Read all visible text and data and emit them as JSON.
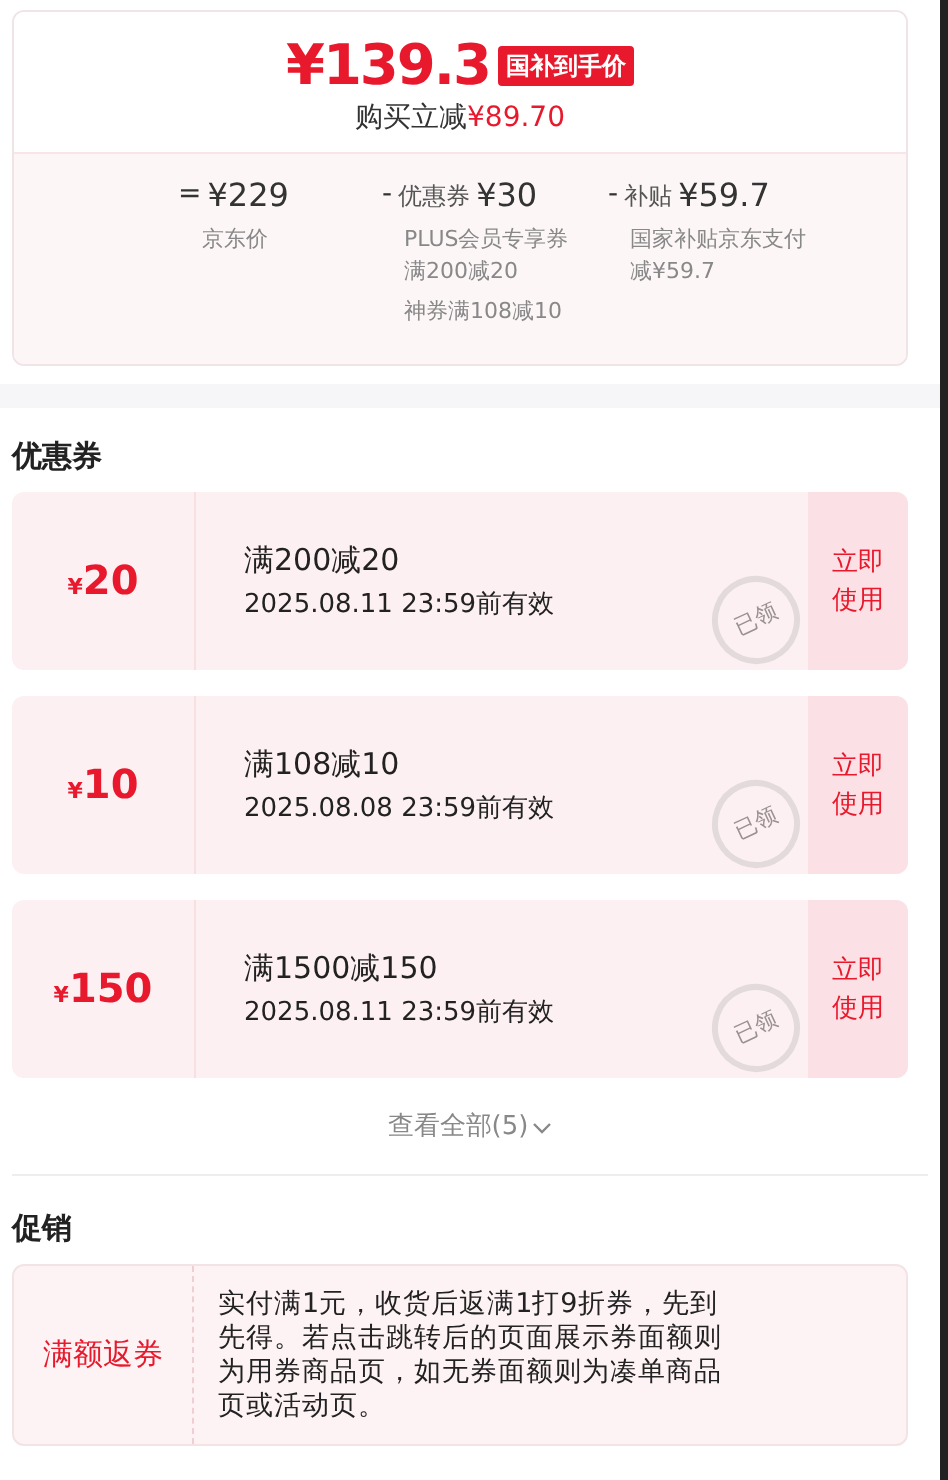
{
  "price_card": {
    "price": "¥139.3",
    "badge": "国补到手价",
    "saving_label": "购买立减",
    "saving_amount": "¥89.70",
    "breakdown": [
      {
        "operator": "=",
        "amount": "¥229",
        "notes": [
          "京东价"
        ]
      },
      {
        "operator": "-",
        "label": "优惠券",
        "amount": "¥30",
        "notes": [
          "PLUS会员专享券满200减20",
          "神券满108减10"
        ]
      },
      {
        "operator": "-",
        "label": "补贴",
        "amount": "¥59.7",
        "notes": [
          "国家补贴京东支付减¥59.7"
        ]
      }
    ]
  },
  "coupons_section": {
    "title": "优惠券",
    "coupons": [
      {
        "currency": "¥",
        "value": "20",
        "condition": "满200减20",
        "expiry": "2025.08.11 23:59前有效",
        "claimed": true,
        "stamp": "已领",
        "action": "立即使用"
      },
      {
        "currency": "¥",
        "value": "10",
        "condition": "满108减10",
        "expiry": "2025.08.08 23:59前有效",
        "claimed": true,
        "stamp": "已领",
        "action": "立即使用"
      },
      {
        "currency": "¥",
        "value": "150",
        "condition": "满1500减150",
        "expiry": "2025.08.11 23:59前有效",
        "claimed": true,
        "stamp": "已领",
        "action": "立即使用"
      }
    ],
    "view_all": "查看全部(5)"
  },
  "promotions_section": {
    "title": "促销",
    "promotions": [
      {
        "tag": "满额返券",
        "description": "实付满1元，收货后返满1打9折券，先到先得。若点击跳转后的页面展示券面额则为用券商品页，如无券面额则为凑单商品页或活动页。"
      }
    ]
  }
}
